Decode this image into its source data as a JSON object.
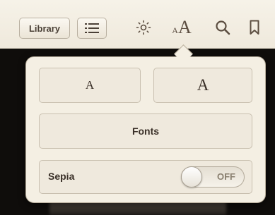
{
  "toolbar": {
    "library_label": "Library",
    "toc_icon": "list-icon",
    "brightness_icon": "sun-icon",
    "font_size_icon_small": "A",
    "font_size_icon_large": "A",
    "search_icon": "search-icon",
    "bookmark_icon": "bookmark-icon"
  },
  "popover": {
    "smaller_font_label": "A",
    "larger_font_label": "A",
    "fonts_label": "Fonts",
    "sepia_label": "Sepia",
    "sepia_toggle_state": "OFF"
  },
  "colors": {
    "toolbar_bg": "#f2ede2",
    "popover_bg": "#f4efe3",
    "text": "#3a3028",
    "icon": "#5b4d40"
  }
}
